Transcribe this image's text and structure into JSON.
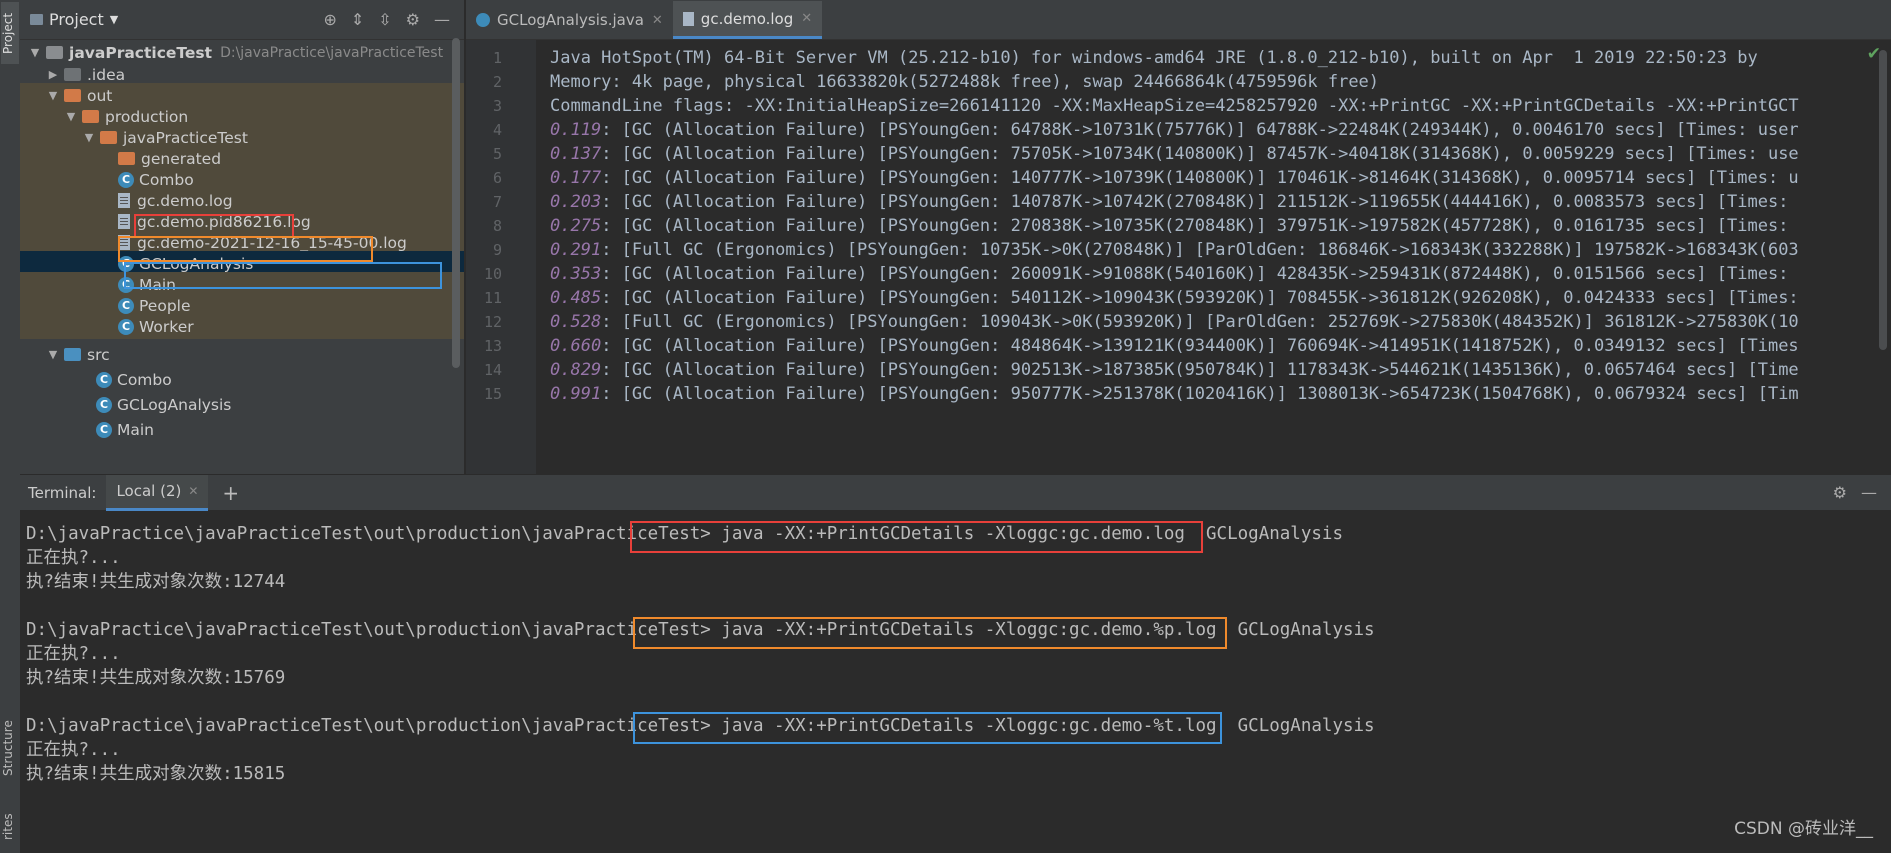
{
  "sidebar_tabs": {
    "project": "Project",
    "structure": "Structure",
    "favorites": "rites"
  },
  "project_panel": {
    "title": "Project",
    "tree": [
      {
        "label": "javaPracticeTest",
        "hint": "D:\\javaPractice\\javaPracticeTest",
        "icon": "folder-icon"
      },
      {
        "label": ".idea",
        "icon": "folder-icon"
      },
      {
        "label": "out",
        "icon": "folder-icon"
      },
      {
        "label": "production",
        "icon": "folder-icon"
      },
      {
        "label": "javaPracticeTest",
        "icon": "folder-icon"
      },
      {
        "label": "generated",
        "icon": "folder-icon"
      },
      {
        "label": "Combo",
        "icon": "class-icon"
      },
      {
        "label": "gc.demo.log",
        "icon": "log-file-icon"
      },
      {
        "label": "gc.demo.pid86216.log",
        "icon": "log-file-icon"
      },
      {
        "label": "gc.demo-2021-12-16_15-45-00.log",
        "icon": "log-file-icon"
      },
      {
        "label": "GCLogAnalysis",
        "icon": "class-icon"
      },
      {
        "label": "Main",
        "icon": "class-icon"
      },
      {
        "label": "People",
        "icon": "class-icon"
      },
      {
        "label": "Worker",
        "icon": "class-icon"
      },
      {
        "label": "src",
        "icon": "folder-icon"
      },
      {
        "label": "Combo",
        "icon": "class-icon"
      },
      {
        "label": "GCLogAnalysis",
        "icon": "class-icon"
      },
      {
        "label": "Main",
        "icon": "class-icon"
      }
    ]
  },
  "editor": {
    "tabs": [
      {
        "label": "GCLogAnalysis.java",
        "icon": "java-class-icon"
      },
      {
        "label": "gc.demo.log",
        "icon": "log-file-icon"
      }
    ],
    "lines": [
      {
        "n": "1",
        "ts": "",
        "text": "Java HotSpot(TM) 64-Bit Server VM (25.212-b10) for windows-amd64 JRE (1.8.0_212-b10), built on Apr  1 2019 22:50:23 by"
      },
      {
        "n": "2",
        "ts": "",
        "text": "Memory: 4k page, physical 16633820k(5272488k free), swap 24466864k(4759596k free)"
      },
      {
        "n": "3",
        "ts": "",
        "text": "CommandLine flags: -XX:InitialHeapSize=266141120 -XX:MaxHeapSize=4258257920 -XX:+PrintGC -XX:+PrintGCDetails -XX:+PrintGCT"
      },
      {
        "n": "4",
        "ts": "0.119",
        "text": ": [GC (Allocation Failure) [PSYoungGen: 64788K->10731K(75776K)] 64788K->22484K(249344K), 0.0046170 secs] [Times: user"
      },
      {
        "n": "5",
        "ts": "0.137",
        "text": ": [GC (Allocation Failure) [PSYoungGen: 75705K->10734K(140800K)] 87457K->40418K(314368K), 0.0059229 secs] [Times: use"
      },
      {
        "n": "6",
        "ts": "0.177",
        "text": ": [GC (Allocation Failure) [PSYoungGen: 140777K->10739K(140800K)] 170461K->81464K(314368K), 0.0095714 secs] [Times: u"
      },
      {
        "n": "7",
        "ts": "0.203",
        "text": ": [GC (Allocation Failure) [PSYoungGen: 140787K->10742K(270848K)] 211512K->119655K(444416K), 0.0083573 secs] [Times:"
      },
      {
        "n": "8",
        "ts": "0.275",
        "text": ": [GC (Allocation Failure) [PSYoungGen: 270838K->10735K(270848K)] 379751K->197582K(457728K), 0.0161735 secs] [Times:"
      },
      {
        "n": "9",
        "ts": "0.291",
        "text": ": [Full GC (Ergonomics) [PSYoungGen: 10735K->0K(270848K)] [ParOldGen: 186846K->168343K(332288K)] 197582K->168343K(603"
      },
      {
        "n": "10",
        "ts": "0.353",
        "text": ": [GC (Allocation Failure) [PSYoungGen: 260091K->91088K(540160K)] 428435K->259431K(872448K), 0.0151566 secs] [Times:"
      },
      {
        "n": "11",
        "ts": "0.485",
        "text": ": [GC (Allocation Failure) [PSYoungGen: 540112K->109043K(593920K)] 708455K->361812K(926208K), 0.0424333 secs] [Times:"
      },
      {
        "n": "12",
        "ts": "0.528",
        "text": ": [Full GC (Ergonomics) [PSYoungGen: 109043K->0K(593920K)] [ParOldGen: 252769K->275830K(484352K)] 361812K->275830K(10"
      },
      {
        "n": "13",
        "ts": "0.660",
        "text": ": [GC (Allocation Failure) [PSYoungGen: 484864K->139121K(934400K)] 760694K->414951K(1418752K), 0.0349132 secs] [Times"
      },
      {
        "n": "14",
        "ts": "0.829",
        "text": ": [GC (Allocation Failure) [PSYoungGen: 902513K->187385K(950784K)] 1178343K->544621K(1435136K), 0.0657464 secs] [Time"
      },
      {
        "n": "15",
        "ts": "0.991",
        "text": ": [GC (Allocation Failure) [PSYoungGen: 950777K->251378K(1020416K)] 1308013K->654723K(1504768K), 0.0679324 secs] [Tim"
      }
    ]
  },
  "terminal": {
    "label": "Terminal:",
    "tab": "Local (2)",
    "add": "+",
    "lines": [
      "D:\\javaPractice\\javaPracticeTest\\out\\production\\javaPracticeTest> java -XX:+PrintGCDetails -Xloggc:gc.demo.log  GCLogAnalysis",
      "正在执?...",
      "执?结束!共生成对象次数:12744",
      "",
      "D:\\javaPractice\\javaPracticeTest\\out\\production\\javaPracticeTest> java -XX:+PrintGCDetails -Xloggc:gc.demo.%p.log  GCLogAnalysis",
      "正在执?...",
      "执?结束!共生成对象次数:15769",
      "",
      "D:\\javaPractice\\javaPracticeTest\\out\\production\\javaPracticeTest> java -XX:+PrintGCDetails -Xloggc:gc.demo-%t.log  GCLogAnalysis",
      "正在执?...",
      "执?结束!共生成对象次数:15815"
    ]
  },
  "watermark": "CSDN @砖业洋__",
  "colors": {
    "red": "#e8403a",
    "orange": "#f08a2c",
    "blue": "#3d93dc"
  }
}
